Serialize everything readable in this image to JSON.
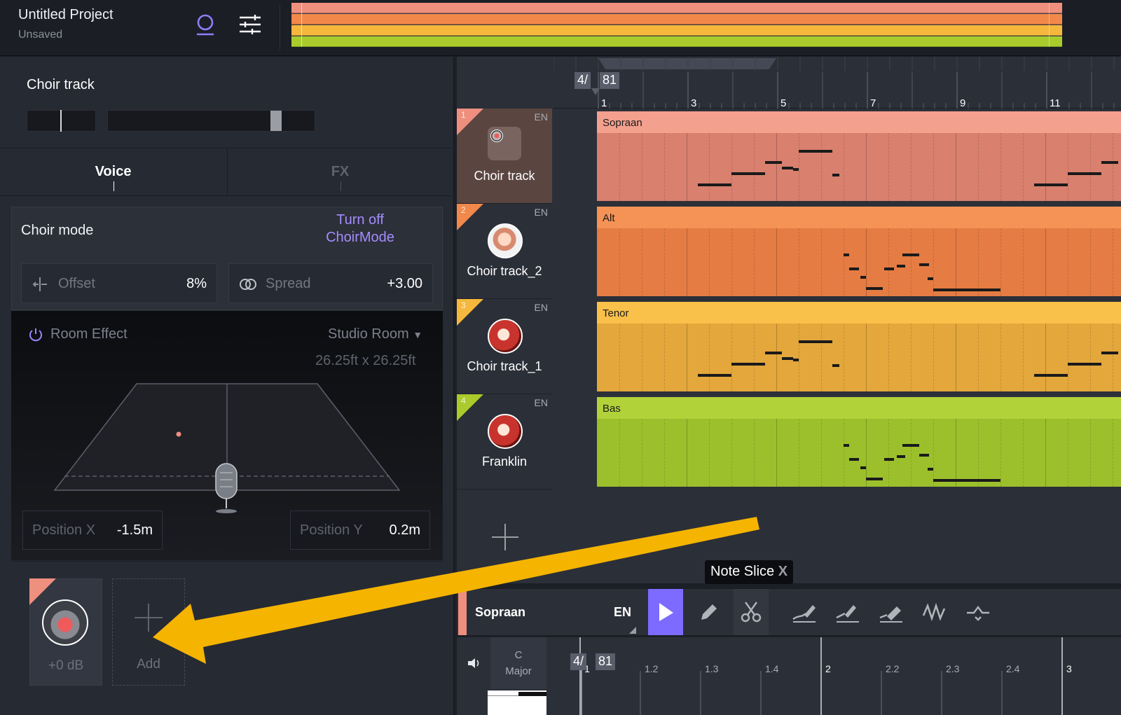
{
  "project": {
    "title": "Untitled Project",
    "status": "Unsaved"
  },
  "left_panel": {
    "section_title": "Choir track",
    "tabs": [
      {
        "label": "Voice",
        "active": true
      },
      {
        "label": "FX",
        "active": false
      }
    ],
    "choir_mode": {
      "label": "Choir mode",
      "toggle_label": "Turn off ChoirMode"
    },
    "offset": {
      "label": "Offset",
      "value": "8%"
    },
    "spread": {
      "label": "Spread",
      "value": "+3.00"
    },
    "room_effect": {
      "label": "Room Effect",
      "room_type": "Studio Room",
      "room_size": "26.25ft x 26.25ft"
    },
    "position_x": {
      "label": "Position X",
      "value": "-1.5m"
    },
    "position_y": {
      "label": "Position Y",
      "value": "0.2m"
    },
    "voice_card": {
      "db": "+0 dB"
    },
    "add_card": {
      "label": "Add"
    }
  },
  "arrangement": {
    "time_signature": {
      "top": "4/",
      "bottom": "81"
    },
    "bar_numbers": [
      "1",
      "3",
      "5",
      "7",
      "9",
      "11"
    ],
    "tracks": [
      {
        "number": "1",
        "name": "Choir track",
        "lang": "EN",
        "clip": "Sopraan",
        "color": "#ef8f7e"
      },
      {
        "number": "2",
        "name": "Choir track_2",
        "lang": "EN",
        "clip": "Alt",
        "color": "#f2884a"
      },
      {
        "number": "3",
        "name": "Choir track_1",
        "lang": "EN",
        "clip": "Tenor",
        "color": "#f5b83d"
      },
      {
        "number": "4",
        "name": "Franklin",
        "lang": "EN",
        "clip": "Bas",
        "color": "#a9cc2c"
      }
    ]
  },
  "tooltip": {
    "text": "Note Slice",
    "shortcut": "X"
  },
  "editor": {
    "clip_name": "Sopraan",
    "lang": "EN",
    "key": {
      "root": "C",
      "scale": "Major"
    },
    "time_signature": {
      "top": "4/",
      "bottom": "81"
    },
    "bar_labels": [
      "1",
      "1.2",
      "1.3",
      "1.4",
      "2",
      "2.2",
      "2.3",
      "2.4",
      "3"
    ]
  },
  "icons": [
    "user-icon",
    "mixer-icon",
    "power-icon",
    "offset-icon",
    "spread-icon",
    "pointer-icon",
    "pencil-icon",
    "scissors-icon",
    "pitch-draw-icon",
    "pitch-flatten-icon",
    "pitch-smooth-icon",
    "vibrato-icon",
    "pitch-transpose-icon",
    "speaker-icon",
    "plus-icon"
  ],
  "colors": {
    "accent": "#7d6bff",
    "accent_text": "#a48cff",
    "arrow": "#f5b400"
  }
}
